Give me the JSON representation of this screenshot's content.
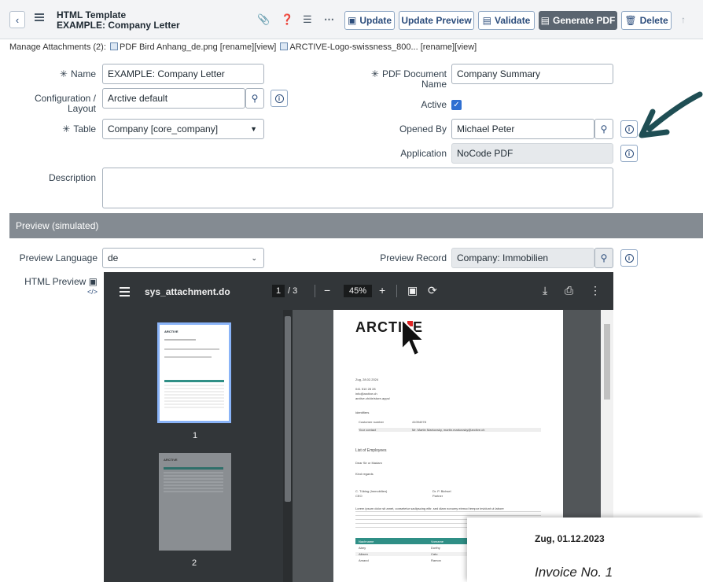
{
  "header": {
    "back_icon": "chevron-left-icon",
    "title_line1": "HTML Template",
    "title_line2": "EXAMPLE: Company Letter",
    "buttons": {
      "update": "Update",
      "update_preview": "Update Preview",
      "validate": "Validate",
      "generate_pdf": "Generate PDF",
      "delete": "Delete"
    }
  },
  "attachments": {
    "label": "Manage Attachments (2):",
    "files": [
      {
        "name": "PDF Bird Anhang_de.png",
        "actions": "[rename][view]"
      },
      {
        "name": "ARCTIVE-Logo-swissness_800...",
        "actions": "[rename][view]"
      }
    ]
  },
  "form": {
    "name_label": "Name",
    "name_value": "EXAMPLE: Company Letter",
    "config_label_1": "Configuration /",
    "config_label_2": "Layout",
    "config_value": "Arctive default",
    "table_label": "Table",
    "table_value": "Company [core_company]",
    "description_label": "Description",
    "description_value": "",
    "pdf_doc_label_1": "PDF Document",
    "pdf_doc_label_2": "Name",
    "pdf_doc_value": "Company Summary",
    "active_label": "Active",
    "opened_by_label": "Opened By",
    "opened_by_value": "Michael Peter",
    "application_label": "Application",
    "application_value": "NoCode PDF",
    "required_mark": "✳"
  },
  "preview": {
    "section_title": "Preview (simulated)",
    "language_label": "Preview Language",
    "language_value": "de",
    "record_label": "Preview Record",
    "record_value": "Company: Immobilien",
    "html_preview_label": "HTML Preview"
  },
  "viewer": {
    "filename": "sys_attachment.do",
    "current_page": "1",
    "total_pages": "/ 3",
    "zoom": "45%",
    "thumb_pages": [
      "1",
      "2"
    ],
    "page_content": {
      "logo": "ARCTIVE",
      "date": "Zug, 28.02.2024",
      "phone": "041 510 28 28",
      "email": "info@arctive.ch",
      "web": "arctive.ch/de/store-apps/",
      "identifiers": "Identifiers",
      "customer_number_label": "Customer number",
      "customer_number": "41094078",
      "contact_label": "Your contact",
      "contact_value": "Mr. Martin Markovsky, martin.markovsky@arctive.ch",
      "list_title": "List of Employees",
      "greeting": "Dear Sir or Madam",
      "kind_regards": "Kind regards",
      "sig1_name": "C. Tübing (Immobilien)",
      "sig1_role": "CEO",
      "sig2_name": "Dr. P. Bichsel",
      "sig2_role": "Partner",
      "lorem": "Lorem ipsum dolor sit amet, consetetur sadipscing elitr, sed diam nonumy eirmod tempor invidunt ut labore",
      "table_headers": [
        "Nachname",
        "Vorname",
        "Beg"
      ],
      "table_rows": [
        [
          "Abey",
          "Dorthy",
          "201"
        ],
        [
          "Alksen",
          "Cato",
          "201"
        ],
        [
          "Amand",
          "Ramon",
          "202"
        ]
      ]
    }
  },
  "invoice_overlay": {
    "date": "Zug, 01.12.2023",
    "number": "Invoice No. 1"
  },
  "colors": {
    "accent_blue": "#2c4d7c",
    "section_gray": "#848b92",
    "viewer_dark": "#323639",
    "arrow_teal": "#1f4e54",
    "table_teal": "#2f8f86"
  }
}
